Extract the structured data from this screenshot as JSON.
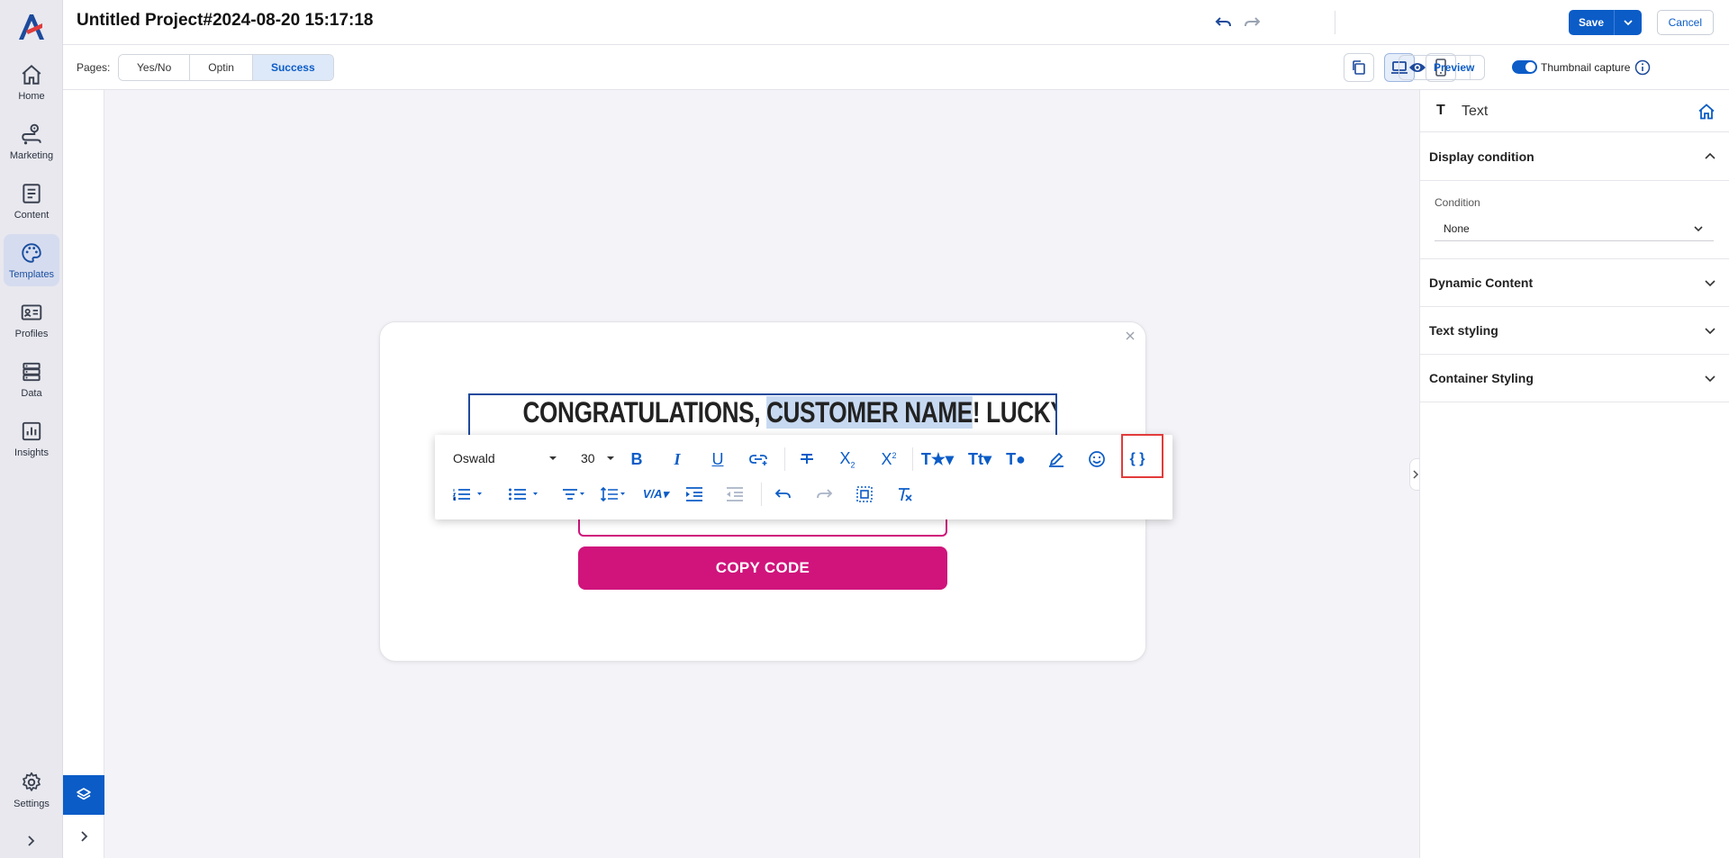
{
  "app": {
    "project_title": "Untitled Project#2024-08-20 15:17:18",
    "save_label": "Save",
    "cancel_label": "Cancel"
  },
  "sidebar": {
    "items": [
      {
        "label": "Home",
        "icon": "home-icon"
      },
      {
        "label": "Marketing",
        "icon": "route-icon"
      },
      {
        "label": "Content",
        "icon": "document-icon"
      },
      {
        "label": "Templates",
        "icon": "palette-icon",
        "active": true
      },
      {
        "label": "Profiles",
        "icon": "id-card-icon"
      },
      {
        "label": "Data",
        "icon": "database-icon"
      },
      {
        "label": "Insights",
        "icon": "bar-chart-icon"
      }
    ],
    "settings_label": "Settings"
  },
  "toolbar": {
    "pages_label": "Pages:",
    "pages": [
      "Yes/No",
      "Optin",
      "Success"
    ],
    "active_page": "Success",
    "preview_label": "Preview",
    "thumbnail_label": "Thumbnail capture",
    "thumbnail_enabled": true
  },
  "popup": {
    "headline_prefix": "CONGRATULATIONS, ",
    "headline_selected": "CUSTOMER NAME",
    "headline_suffix": "! LUCKY DAY!",
    "copy_button_label": "COPY CODE",
    "accent_color": "#d0147c"
  },
  "editor": {
    "font_family": "Oswald",
    "font_size": "30",
    "buttons_row1": [
      "bold",
      "italic",
      "underline",
      "insert-link",
      "strikethrough",
      "subscript",
      "superscript",
      "inline-style",
      "font-size-style",
      "text-color",
      "highlight",
      "emoji",
      "dynamic-content"
    ],
    "buttons_row2": [
      "ordered-list",
      "unordered-list",
      "align",
      "line-height",
      "letter-spacing",
      "indent",
      "outdent",
      "undo",
      "redo",
      "select-all",
      "clear-formatting"
    ]
  },
  "right_panel": {
    "element_type": "Text",
    "sections": [
      {
        "label": "Display condition",
        "expanded": true
      },
      {
        "label": "Dynamic Content",
        "expanded": false
      },
      {
        "label": "Text styling",
        "expanded": false
      },
      {
        "label": "Container Styling",
        "expanded": false
      }
    ],
    "condition_label": "Condition",
    "condition_value": "None"
  }
}
